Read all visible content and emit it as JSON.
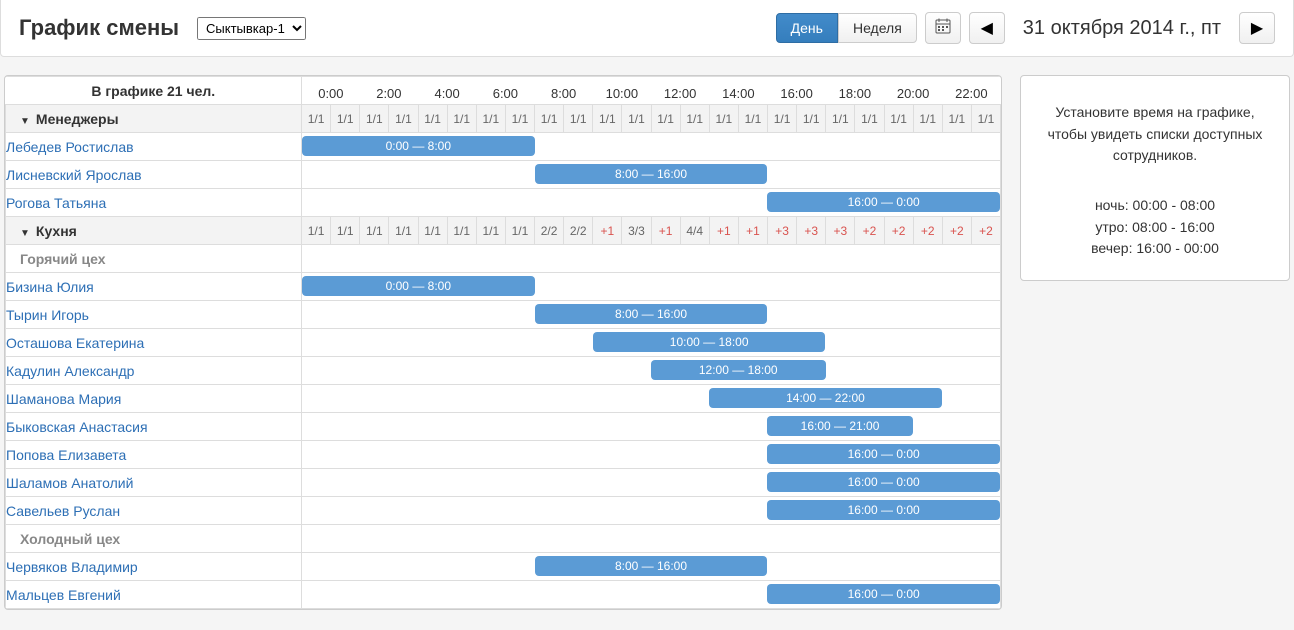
{
  "header": {
    "title": "График смены",
    "location_options": [
      "Сыктывкар-1"
    ],
    "selected_location": "Сыктывкар-1",
    "view_day": "День",
    "view_week": "Неделя",
    "calendar_icon": "calendar-icon",
    "prev_icon": "chevron-left-icon",
    "next_icon": "chevron-right-icon",
    "date_label": "31 октября 2014 г., пт"
  },
  "side": {
    "instruction": "Установите время на графике, чтобы увидеть списки доступных сотрудников.",
    "lines": [
      "ночь: 00:00 - 08:00",
      "утро: 08:00 - 16:00",
      "вечер: 16:00 - 00:00"
    ]
  },
  "schedule": {
    "summary": "В графике 21 чел.",
    "major_hours": [
      "0:00",
      "2:00",
      "4:00",
      "6:00",
      "8:00",
      "10:00",
      "12:00",
      "14:00",
      "16:00",
      "18:00",
      "20:00",
      "22:00"
    ],
    "groups": [
      {
        "name": "Менеджеры",
        "counts": [
          "1/1",
          "1/1",
          "1/1",
          "1/1",
          "1/1",
          "1/1",
          "1/1",
          "1/1",
          "1/1",
          "1/1",
          "1/1",
          "1/1",
          "1/1",
          "1/1",
          "1/1",
          "1/1",
          "1/1",
          "1/1",
          "1/1",
          "1/1",
          "1/1",
          "1/1",
          "1/1",
          "1/1"
        ],
        "count_flags": [
          "",
          "",
          "",
          "",
          "",
          "",
          "",
          "",
          "",
          "",
          "",
          "",
          "",
          "",
          "",
          "",
          "",
          "",
          "",
          "",
          "",
          "",
          "",
          ""
        ],
        "rows": [
          {
            "name": "Лебедев Ростислав",
            "bar": {
              "start": 0,
              "end": 8,
              "label": "0:00 — 8:00"
            }
          },
          {
            "name": "Лисневский Ярослав",
            "bar": {
              "start": 8,
              "end": 16,
              "label": "8:00 — 16:00"
            }
          },
          {
            "name": "Рогова Татьяна",
            "bar": {
              "start": 16,
              "end": 24,
              "label": "16:00 — 0:00"
            }
          }
        ]
      },
      {
        "name": "Кухня",
        "counts": [
          "1/1",
          "1/1",
          "1/1",
          "1/1",
          "1/1",
          "1/1",
          "1/1",
          "1/1",
          "2/2",
          "2/2",
          "+1",
          "3/3",
          "+1",
          "4/4",
          "+1",
          "+1",
          "+3",
          "+3",
          "+3",
          "+2",
          "+2",
          "+2",
          "+2",
          "+2"
        ],
        "count_flags": [
          "",
          "",
          "",
          "",
          "",
          "",
          "",
          "",
          "",
          "",
          "over",
          "",
          "over",
          "",
          "over",
          "over",
          "over",
          "over",
          "over",
          "over",
          "over",
          "over",
          "over",
          "over"
        ],
        "subgroups": [
          {
            "name": "Горячий цех",
            "rows": [
              {
                "name": "Бизина Юлия",
                "bar": {
                  "start": 0,
                  "end": 8,
                  "label": "0:00 — 8:00"
                }
              },
              {
                "name": "Тырин Игорь",
                "bar": {
                  "start": 8,
                  "end": 16,
                  "label": "8:00 — 16:00"
                }
              },
              {
                "name": "Осташова Екатерина",
                "bar": {
                  "start": 10,
                  "end": 18,
                  "label": "10:00 — 18:00"
                }
              },
              {
                "name": "Кадулин Александр",
                "bar": {
                  "start": 12,
                  "end": 18,
                  "label": "12:00 — 18:00"
                }
              },
              {
                "name": "Шаманова Мария",
                "bar": {
                  "start": 14,
                  "end": 22,
                  "label": "14:00 — 22:00"
                }
              },
              {
                "name": "Быковская Анастасия",
                "bar": {
                  "start": 16,
                  "end": 21,
                  "label": "16:00 — 21:00"
                }
              },
              {
                "name": "Попова Елизавета",
                "bar": {
                  "start": 16,
                  "end": 24,
                  "label": "16:00 — 0:00"
                }
              },
              {
                "name": "Шаламов Анатолий",
                "bar": {
                  "start": 16,
                  "end": 24,
                  "label": "16:00 — 0:00"
                }
              },
              {
                "name": "Савельев Руслан",
                "bar": {
                  "start": 16,
                  "end": 24,
                  "label": "16:00 — 0:00"
                }
              }
            ]
          },
          {
            "name": "Холодный цех",
            "rows": [
              {
                "name": "Червяков Владимир",
                "bar": {
                  "start": 8,
                  "end": 16,
                  "label": "8:00 — 16:00"
                }
              },
              {
                "name": "Мальцев Евгений",
                "bar": {
                  "start": 16,
                  "end": 24,
                  "label": "16:00 — 0:00"
                }
              }
            ]
          }
        ]
      }
    ]
  }
}
